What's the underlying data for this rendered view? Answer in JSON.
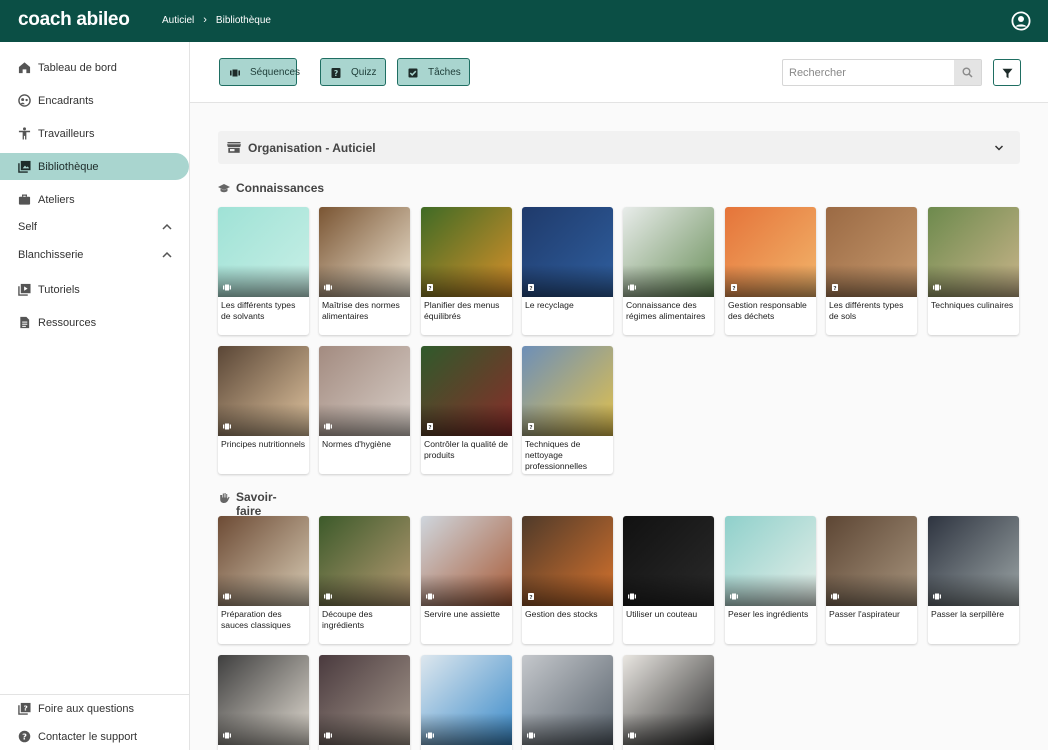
{
  "header": {
    "logo": "coach abileo",
    "breadcrumb": [
      "Auticiel",
      "Bibliothèque"
    ]
  },
  "sidebar": {
    "items": [
      {
        "label": "Tableau de bord",
        "icon": "home-icon"
      },
      {
        "label": "Encadrants",
        "icon": "supervisor-icon"
      },
      {
        "label": "Travailleurs",
        "icon": "person-icon"
      },
      {
        "label": "Bibliothèque",
        "icon": "library-icon",
        "active": true
      },
      {
        "label": "Ateliers",
        "icon": "briefcase-icon"
      }
    ],
    "sections": [
      {
        "label": "Self",
        "expanded": true
      },
      {
        "label": "Blanchisserie",
        "expanded": true
      }
    ],
    "extra": [
      {
        "label": "Tutoriels",
        "icon": "video-icon"
      },
      {
        "label": "Ressources",
        "icon": "document-icon"
      }
    ],
    "bottom": [
      {
        "label": "Foire aux questions",
        "icon": "faq-icon"
      },
      {
        "label": "Contacter le support",
        "icon": "help-icon"
      }
    ]
  },
  "toolbar": {
    "buttons": [
      {
        "label": "Séquences",
        "icon": "sequence-icon"
      },
      {
        "label": "Quizz",
        "icon": "quiz-icon"
      },
      {
        "label": "Tâches",
        "icon": "task-icon"
      }
    ],
    "search_placeholder": "Rechercher"
  },
  "group": {
    "label": "Organisation - Auticiel"
  },
  "sections": [
    {
      "label": "Connaissances",
      "icon": "graduation-cap-icon",
      "cards": [
        {
          "title": "Les différents types de solvants",
          "badge": "sequence"
        },
        {
          "title": "Maîtrise des normes alimentaires",
          "badge": "sequence"
        },
        {
          "title": "Planifier des menus équilibrés",
          "badge": "quiz"
        },
        {
          "title": "Le recyclage",
          "badge": "quiz"
        },
        {
          "title": "Connaissance des régimes alimentaires",
          "badge": "sequence"
        },
        {
          "title": "Gestion responsable des déchets",
          "badge": "quiz"
        },
        {
          "title": "Les différents types de sols",
          "badge": "quiz"
        },
        {
          "title": "Techniques culinaires",
          "badge": "sequence"
        },
        {
          "title": "Principes nutritionnels",
          "badge": "sequence"
        },
        {
          "title": "Normes d'hygiène",
          "badge": "sequence"
        },
        {
          "title": "Contrôler la qualité de produits",
          "badge": "quiz"
        },
        {
          "title": "Techniques de nettoyage professionnelles",
          "badge": "quiz"
        }
      ]
    },
    {
      "label": "Savoir-faire",
      "icon": "hand-icon",
      "cards": [
        {
          "title": "Préparation des sauces classiques",
          "badge": "sequence"
        },
        {
          "title": "Découpe des ingrédients",
          "badge": "sequence"
        },
        {
          "title": "Servire une assiette",
          "badge": "sequence"
        },
        {
          "title": "Gestion des stocks",
          "badge": "quiz"
        },
        {
          "title": "Utiliser un couteau",
          "badge": "sequence"
        },
        {
          "title": "Peser les ingrédients",
          "badge": "sequence"
        },
        {
          "title": "Passer l'aspirateur",
          "badge": "sequence"
        },
        {
          "title": "Passer la serpillère",
          "badge": "sequence"
        },
        {
          "title": "",
          "badge": "sequence"
        },
        {
          "title": "",
          "badge": "sequence"
        },
        {
          "title": "",
          "badge": "sequence"
        },
        {
          "title": "",
          "badge": "sequence"
        },
        {
          "title": "",
          "badge": "sequence"
        }
      ]
    }
  ],
  "colors": {
    "header": "#0b4f45",
    "accent": "#a9d5cf",
    "accent_border": "#1f6e62"
  }
}
